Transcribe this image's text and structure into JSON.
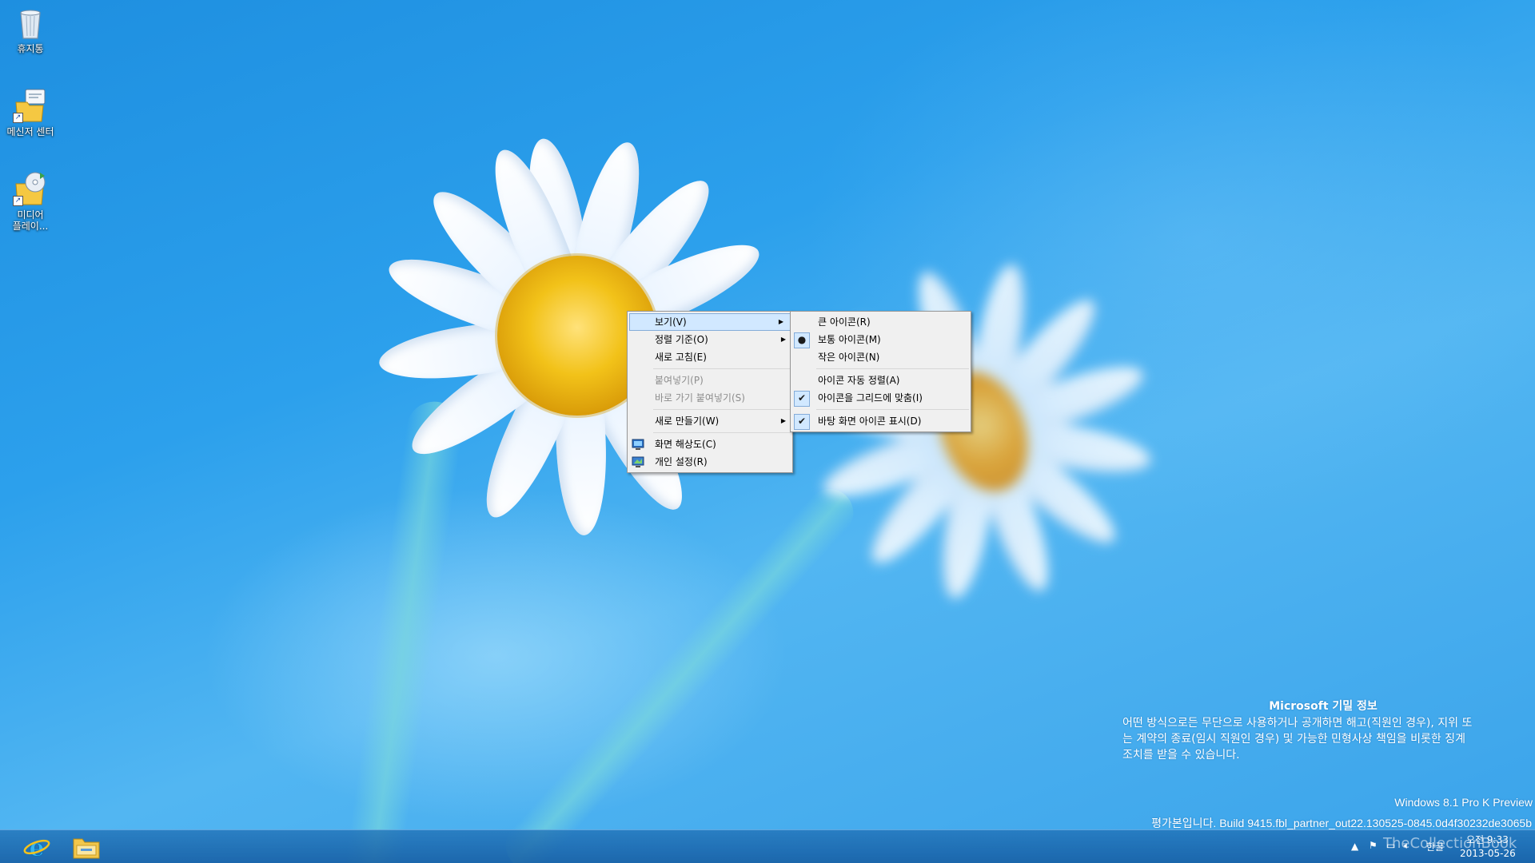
{
  "desktop": {
    "icons": [
      {
        "label": "휴지통",
        "icon": "recycle-bin-icon"
      },
      {
        "label": "메신저 센터",
        "icon": "messenger-center-icon"
      },
      {
        "label": "미디어\n플레이...",
        "icon": "media-player-icon"
      }
    ]
  },
  "context_menu": {
    "items": [
      {
        "label": "보기(V)",
        "submenu": true,
        "active": true
      },
      {
        "label": "정렬 기준(O)",
        "submenu": true
      },
      {
        "label": "새로 고침(E)"
      },
      {
        "label": "붙여넣기(P)",
        "disabled": true
      },
      {
        "label": "바로 가기 붙여넣기(S)",
        "disabled": true
      },
      {
        "label": "새로 만들기(W)",
        "submenu": true
      },
      {
        "label": "화면 해상도(C)",
        "icon": "screen-resolution-icon"
      },
      {
        "label": "개인 설정(R)",
        "icon": "personalize-icon"
      }
    ]
  },
  "view_submenu": {
    "items": [
      {
        "label": "큰 아이콘(R)"
      },
      {
        "label": "보통 아이콘(M)",
        "mark": "●"
      },
      {
        "label": "작은 아이콘(N)"
      },
      {
        "label": "아이콘 자동 정렬(A)"
      },
      {
        "label": "아이콘을 그리드에 맞춤(I)",
        "mark": "✔"
      },
      {
        "label": "바탕 화면 아이콘 표시(D)",
        "mark": "✔"
      }
    ]
  },
  "watermark": {
    "title": "Microsoft 기밀 정보",
    "body_line1": "어떤 방식으로든 무단으로 사용하거나 공개하면 해고(직원인 경우), 지위 또",
    "body_line2": "는 계약의 종료(임시 직원인 경우) 및 가능한 민형사상 책임을 비롯한 징계",
    "body_line3": "조치를 받을 수 있습니다.",
    "edition": "Windows 8.1 Pro K Preview",
    "build": "평가본입니다. Build 9415.fbl_partner_out22.130525-0845.0d4f30232de3065b"
  },
  "taskbar": {
    "pinned": [
      {
        "name": "internet-explorer",
        "icon": "internet-explorer-icon"
      },
      {
        "name": "file-explorer",
        "icon": "folder-icon"
      }
    ],
    "tray": {
      "ime_label": "한글",
      "time": "오전 9:33",
      "date": "2013-05-26",
      "overlay_text": "TheCollectionBook"
    }
  },
  "colors": {
    "desktop_blue": "#2ca0ec",
    "menu_bg": "#f0f0f0",
    "menu_highlight": "#d1e8ff",
    "menu_highlight_border": "#84acd9",
    "disabled_text": "#8d8d8d"
  }
}
